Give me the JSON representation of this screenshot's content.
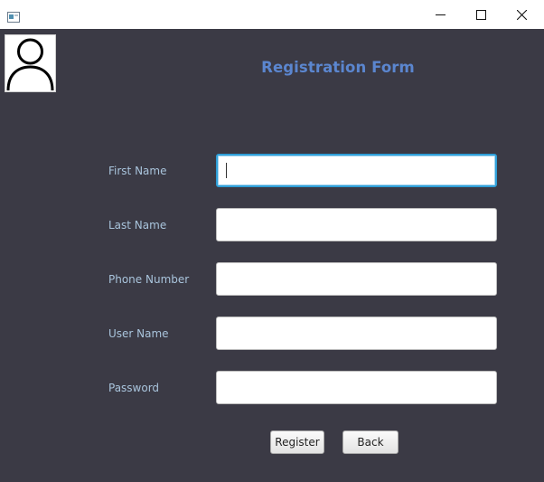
{
  "window": {
    "controls": {
      "minimize_icon": "minimize-icon",
      "maximize_icon": "maximize-icon",
      "close_icon": "close-icon"
    }
  },
  "header": {
    "avatar_icon": "user-avatar-icon",
    "title": "Registration Form"
  },
  "form": {
    "fields": [
      {
        "label": "First Name",
        "value": "",
        "focused": true
      },
      {
        "label": "Last Name",
        "value": ""
      },
      {
        "label": "Phone Number",
        "value": ""
      },
      {
        "label": "User Name",
        "value": ""
      },
      {
        "label": "Password",
        "value": ""
      }
    ],
    "register_label": "Register",
    "back_label": "Back"
  },
  "colors": {
    "background": "#3b3a45",
    "title": "#5b86cf",
    "label": "#a9c4dc",
    "focus": "#2f9fd8"
  }
}
